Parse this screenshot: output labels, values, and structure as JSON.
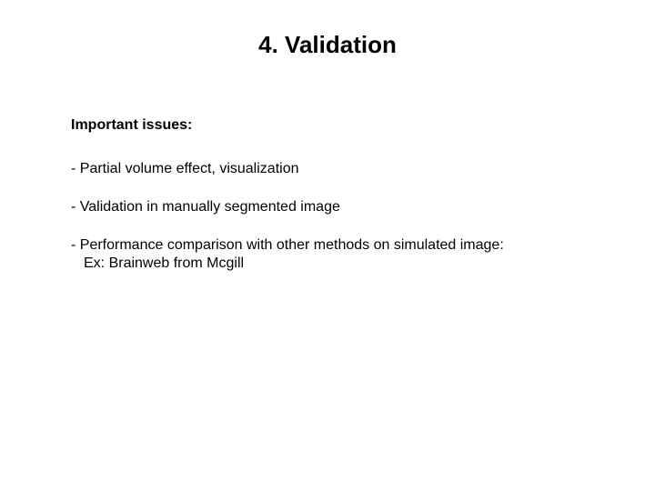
{
  "title": "4. Validation",
  "subhead": "Important issues:",
  "items": [
    {
      "line1": "- Partial volume effect, visualization"
    },
    {
      "line1": "- Validation in manually segmented image"
    },
    {
      "line1": "- Performance comparison with other methods on simulated image:",
      "line2": "Ex: Brainweb from Mcgill"
    }
  ]
}
